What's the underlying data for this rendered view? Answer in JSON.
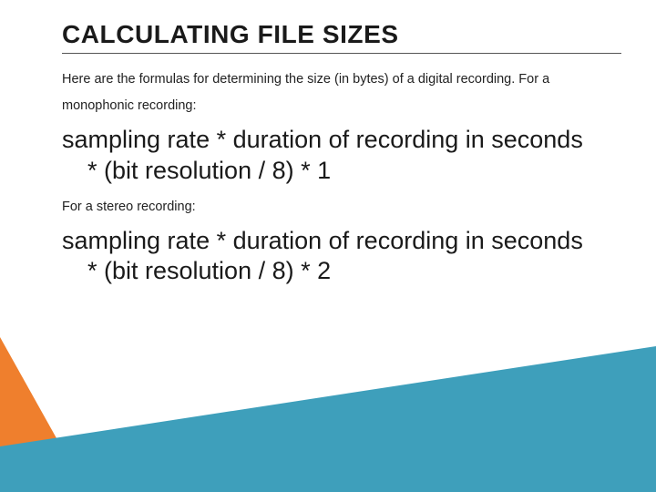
{
  "slide": {
    "title": "CALCULATING FILE SIZES",
    "intro": "Here are the formulas for determining the size (in bytes) of a digital recording. For a monophonic recording:",
    "formula_mono_line1": "sampling rate * duration of recording in seconds",
    "formula_mono_line2": "* (bit resolution / 8) * 1",
    "stereo_label": "For a stereo recording:",
    "formula_stereo_line1": "sampling rate * duration of recording in seconds",
    "formula_stereo_line2": "* (bit resolution / 8) * 2"
  },
  "colors": {
    "orange": "#ef7f2d",
    "teal": "#3e9fbb"
  }
}
